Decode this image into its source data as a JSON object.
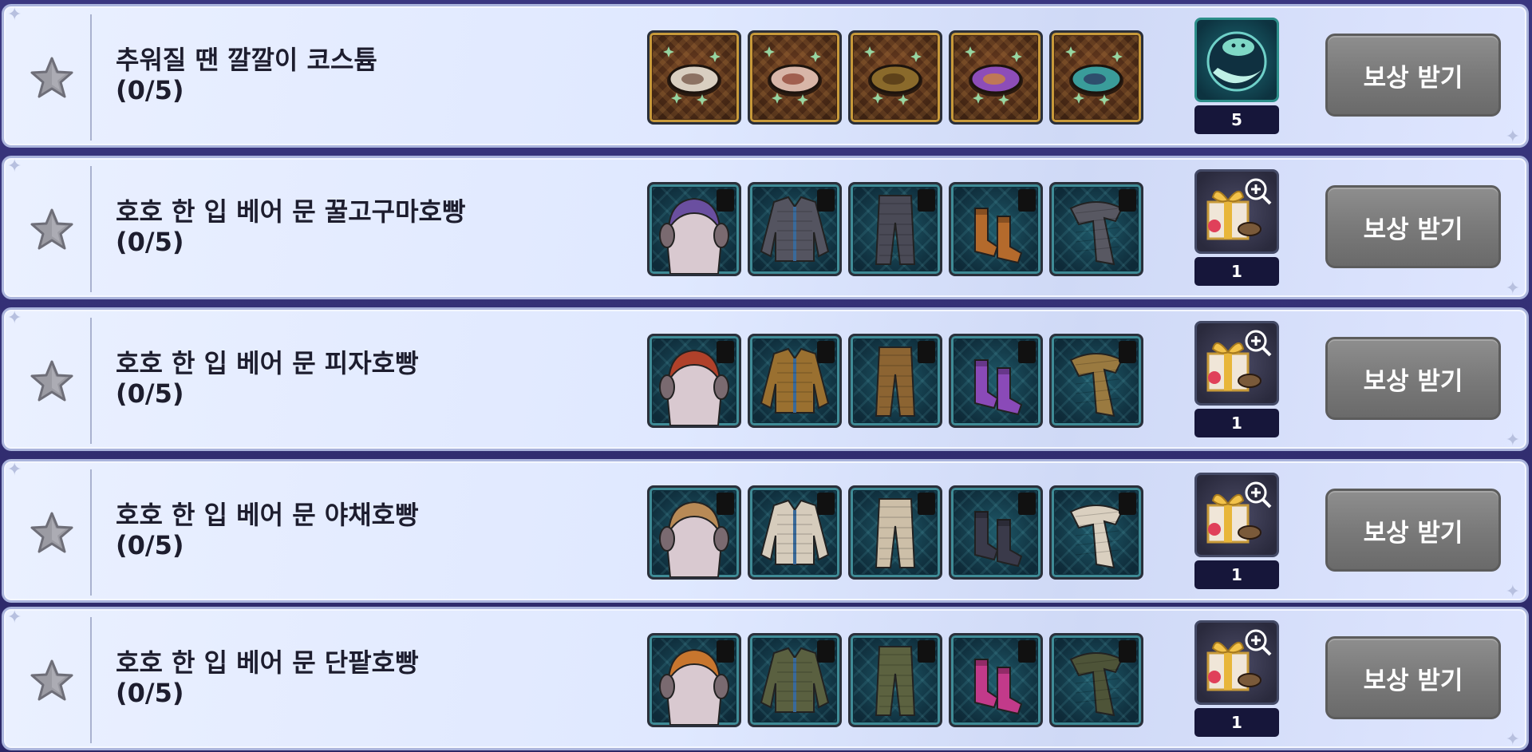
{
  "rows": [
    {
      "title": "추워질 땐 깔깔이 코스튬",
      "progress": "(0/5)",
      "item_type": "cookie",
      "items": [
        {
          "icon": "hobbang-plain-icon",
          "color": "#d9cfc1",
          "accent": "#6b4a3a"
        },
        {
          "icon": "hobbang-red-bean-icon",
          "color": "#d8b6a8",
          "accent": "#8a3b2a"
        },
        {
          "icon": "hobbang-sweet-potato-icon",
          "color": "#8a6a2b",
          "accent": "#4b3214"
        },
        {
          "icon": "hobbang-purple-icon",
          "color": "#8d4db8",
          "accent": "#d48a2c"
        },
        {
          "icon": "hobbang-teal-icon",
          "color": "#3a9c9a",
          "accent": "#2a2e5a"
        }
      ],
      "reward": {
        "icon": "pet-cloud-creature-icon",
        "count": "5",
        "style": "teal"
      },
      "button": "보상 받기"
    },
    {
      "title": "호호 한 입 베어 문 꿀고구마호빵",
      "progress": "(0/5)",
      "item_type": "cloth",
      "items": [
        {
          "icon": "earmuff-hair-icon",
          "color": "#6a4fa0"
        },
        {
          "icon": "padded-jacket-icon",
          "color": "#545460"
        },
        {
          "icon": "quilted-pants-icon",
          "color": "#4a4a56"
        },
        {
          "icon": "socks-icon",
          "color": "#b46a2c"
        },
        {
          "icon": "quilted-scarf-icon",
          "color": "#585862"
        }
      ],
      "reward": {
        "icon": "gift-box-zoom-icon",
        "count": "1",
        "style": "dark"
      },
      "button": "보상 받기"
    },
    {
      "title": "호호 한 입 베어 문 피자호빵",
      "progress": "(0/5)",
      "item_type": "cloth",
      "items": [
        {
          "icon": "earmuff-hair-icon",
          "color": "#b0412a"
        },
        {
          "icon": "padded-jacket-icon",
          "color": "#9a7030"
        },
        {
          "icon": "quilted-pants-icon",
          "color": "#8c6432"
        },
        {
          "icon": "socks-icon",
          "color": "#8a4ab8"
        },
        {
          "icon": "quilted-scarf-icon",
          "color": "#9a7a40"
        }
      ],
      "reward": {
        "icon": "gift-box-zoom-icon",
        "count": "1",
        "style": "dark"
      },
      "button": "보상 받기"
    },
    {
      "title": "호호 한 입 베어 문 야채호빵",
      "progress": "(0/5)",
      "item_type": "cloth",
      "items": [
        {
          "icon": "earmuff-hair-icon",
          "color": "#b88a56"
        },
        {
          "icon": "padded-jacket-icon",
          "color": "#d6ccbc"
        },
        {
          "icon": "quilted-pants-icon",
          "color": "#cdbfa8"
        },
        {
          "icon": "socks-icon",
          "color": "#3a3a4a"
        },
        {
          "icon": "quilted-scarf-icon",
          "color": "#dad0c0"
        }
      ],
      "reward": {
        "icon": "gift-box-zoom-icon",
        "count": "1",
        "style": "dark"
      },
      "button": "보상 받기"
    },
    {
      "title": "호호 한 입 베어 문 단팥호빵",
      "progress": "(0/5)",
      "item_type": "cloth",
      "items": [
        {
          "icon": "earmuff-hair-icon",
          "color": "#c8762e"
        },
        {
          "icon": "padded-jacket-icon",
          "color": "#5a6040"
        },
        {
          "icon": "quilted-pants-icon",
          "color": "#5c6240"
        },
        {
          "icon": "socks-icon",
          "color": "#c23a8a"
        },
        {
          "icon": "quilted-scarf-icon",
          "color": "#4e5438"
        }
      ],
      "reward": {
        "icon": "gift-box-zoom-icon",
        "count": "1",
        "style": "dark"
      },
      "button": "보상 받기"
    }
  ]
}
